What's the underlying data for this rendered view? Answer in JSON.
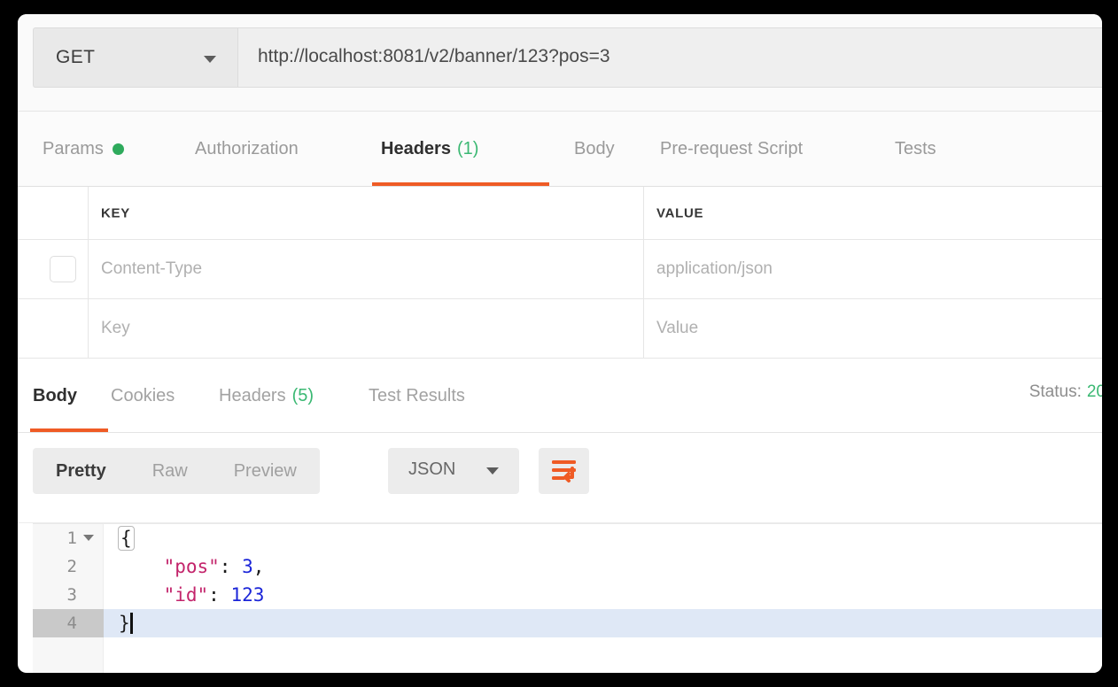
{
  "request": {
    "method": "GET",
    "url": "http://localhost:8081/v2/banner/123?pos=3",
    "tabs": [
      {
        "label": "Params",
        "dot": true,
        "active": false
      },
      {
        "label": "Authorization",
        "active": false
      },
      {
        "label": "Headers",
        "count": "(1)",
        "active": true
      },
      {
        "label": "Body",
        "active": false
      },
      {
        "label": "Pre-request Script",
        "active": false
      },
      {
        "label": "Tests",
        "active": false
      }
    ],
    "headers_table": {
      "columns": [
        "KEY",
        "VALUE"
      ],
      "rows": [
        {
          "key": "Content-Type",
          "value": "application/json",
          "checked": false
        },
        {
          "key": "Key",
          "value": "Value",
          "placeholder_row": true
        }
      ]
    }
  },
  "response": {
    "tabs": [
      {
        "label": "Body",
        "active": true
      },
      {
        "label": "Cookies",
        "active": false
      },
      {
        "label": "Headers",
        "count": "(5)",
        "active": false
      },
      {
        "label": "Test Results",
        "active": false
      }
    ],
    "status_label": "Status:",
    "status_code": "20",
    "toolbar": {
      "view_modes": [
        "Pretty",
        "Raw",
        "Preview"
      ],
      "active_view": "Pretty",
      "format": "JSON",
      "wrap_button": "word-wrap-icon"
    },
    "body": {
      "language": "json",
      "lines": [
        {
          "num": "1",
          "foldable": true,
          "active": false,
          "tokens": [
            {
              "t": "{",
              "c": "punc",
              "brace": true
            }
          ]
        },
        {
          "num": "2",
          "foldable": false,
          "active": false,
          "indent": 4,
          "tokens": [
            {
              "t": "\"pos\"",
              "c": "key"
            },
            {
              "t": ": ",
              "c": "punc"
            },
            {
              "t": "3",
              "c": "num"
            },
            {
              "t": ",",
              "c": "punc"
            }
          ]
        },
        {
          "num": "3",
          "foldable": false,
          "active": false,
          "indent": 4,
          "tokens": [
            {
              "t": "\"id\"",
              "c": "key"
            },
            {
              "t": ": ",
              "c": "punc"
            },
            {
              "t": "123",
              "c": "num"
            }
          ]
        },
        {
          "num": "4",
          "foldable": false,
          "active": true,
          "indent": 0,
          "tokens": [
            {
              "t": "}",
              "c": "punc"
            }
          ],
          "caret": true
        }
      ]
    }
  },
  "colors": {
    "accent": "#ef5b25",
    "green": "#3bb873",
    "json_key": "#c3246b",
    "json_number": "#1b25d8",
    "active_line": "#dfe8f6"
  }
}
